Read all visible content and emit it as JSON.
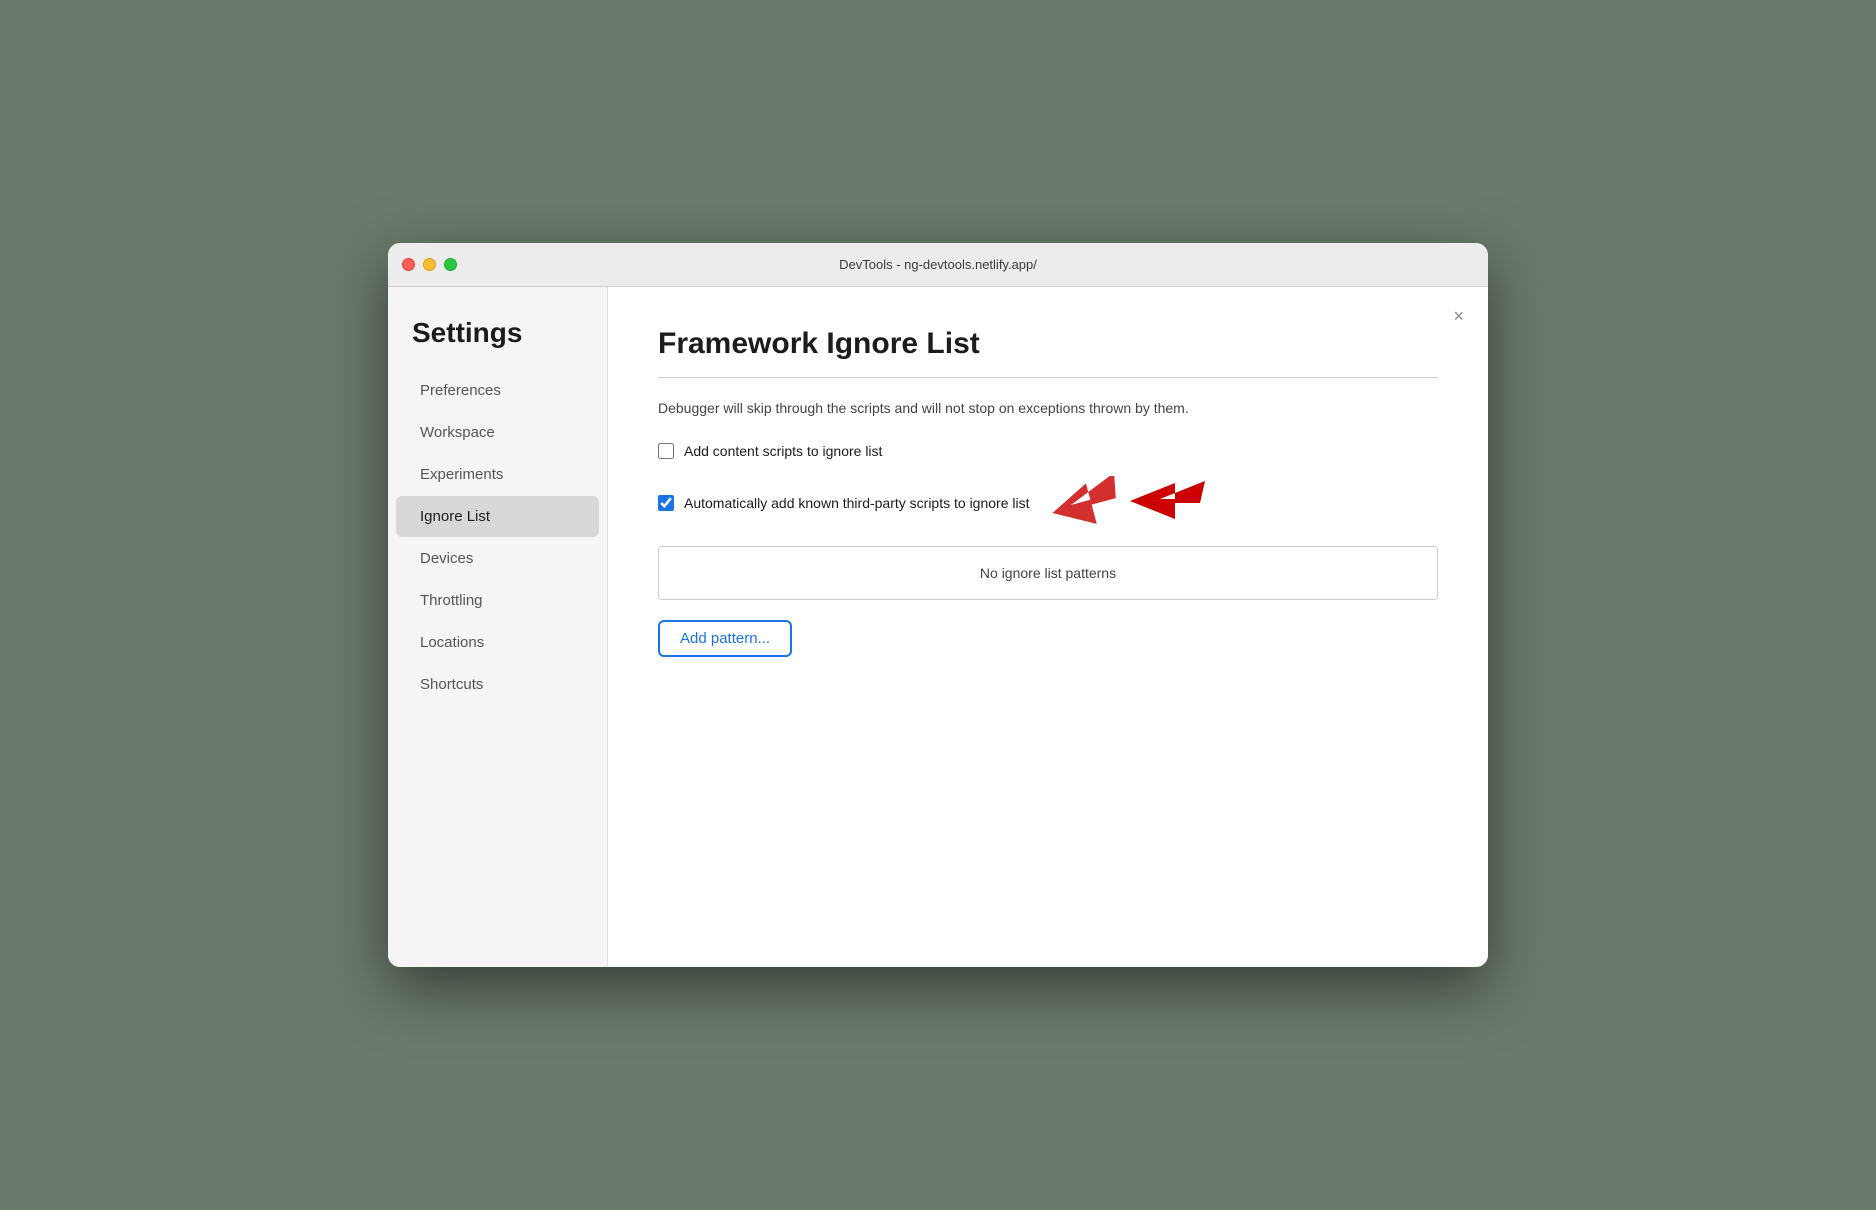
{
  "window": {
    "title": "DevTools - ng-devtools.netlify.app/"
  },
  "sidebar": {
    "title": "Settings",
    "items": [
      {
        "id": "preferences",
        "label": "Preferences",
        "active": false
      },
      {
        "id": "workspace",
        "label": "Workspace",
        "active": false
      },
      {
        "id": "experiments",
        "label": "Experiments",
        "active": false
      },
      {
        "id": "ignore-list",
        "label": "Ignore List",
        "active": true
      },
      {
        "id": "devices",
        "label": "Devices",
        "active": false
      },
      {
        "id": "throttling",
        "label": "Throttling",
        "active": false
      },
      {
        "id": "locations",
        "label": "Locations",
        "active": false
      },
      {
        "id": "shortcuts",
        "label": "Shortcuts",
        "active": false
      }
    ]
  },
  "main": {
    "title": "Framework Ignore List",
    "description": "Debugger will skip through the scripts and will not stop on exceptions thrown by them.",
    "checkboxes": [
      {
        "id": "add-content-scripts",
        "label": "Add content scripts to ignore list",
        "checked": false
      },
      {
        "id": "auto-add-third-party",
        "label": "Automatically add known third-party scripts to ignore list",
        "checked": true
      }
    ],
    "no_patterns_label": "No ignore list patterns",
    "add_pattern_label": "Add pattern...",
    "close_label": "×"
  }
}
